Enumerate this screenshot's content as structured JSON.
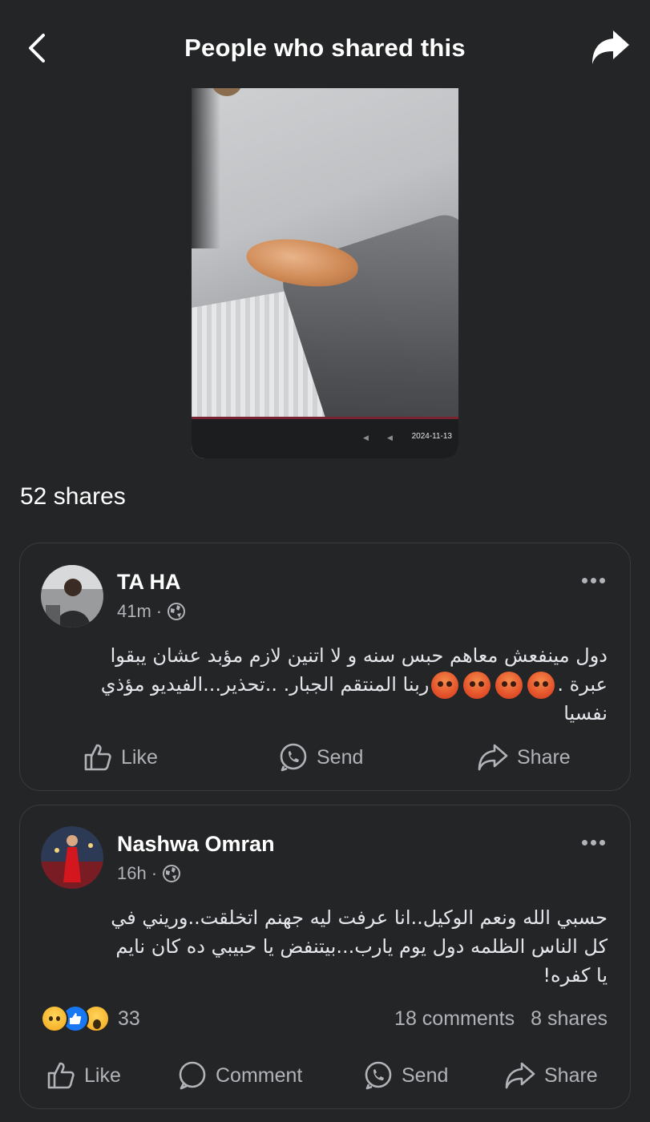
{
  "header": {
    "title": "People who shared this",
    "back_icon": "chevron-left-icon",
    "share_icon": "share-arrow-icon"
  },
  "video": {
    "date": "2024-11-13",
    "controls": [
      "volume-icon",
      "sound-icon"
    ]
  },
  "shares_summary": "52 shares",
  "posts": [
    {
      "name": "TA HA",
      "time": "41m",
      "audience_icon": "globe-icon",
      "text_line1": "دول مينفعش معاهم حبس سنه و لا اتنين لازم مؤبد عشان يبقوا",
      "text_line2_a": "عبرة .",
      "text_line2_b": "ربنا المنتقم الجبار. ..تحذير...الفيديو مؤذي",
      "text_line3": "نفسيا",
      "emojis": [
        "angry-face-icon",
        "angry-face-icon",
        "angry-face-icon",
        "angry-face-icon"
      ],
      "actions": {
        "like": "Like",
        "send": "Send",
        "share": "Share"
      }
    },
    {
      "name": "Nashwa Omran",
      "time": "16h",
      "audience_icon": "globe-icon",
      "text_line1": "حسبي الله ونعم الوكيل..انا عرفت ليه جهنم اتخلقت..وريني في",
      "text_line2": "كل الناس الظلمه دول يوم يارب...بيتنفض يا حبيبي ده كان نايم",
      "text_line3": "يا كفره!",
      "reactions": [
        "sad-reaction-icon",
        "like-reaction-icon",
        "wow-reaction-icon"
      ],
      "reaction_count": "33",
      "comments": "18 comments",
      "shares": "8 shares",
      "actions": {
        "like": "Like",
        "comment": "Comment",
        "send": "Send",
        "share": "Share"
      }
    }
  ]
}
